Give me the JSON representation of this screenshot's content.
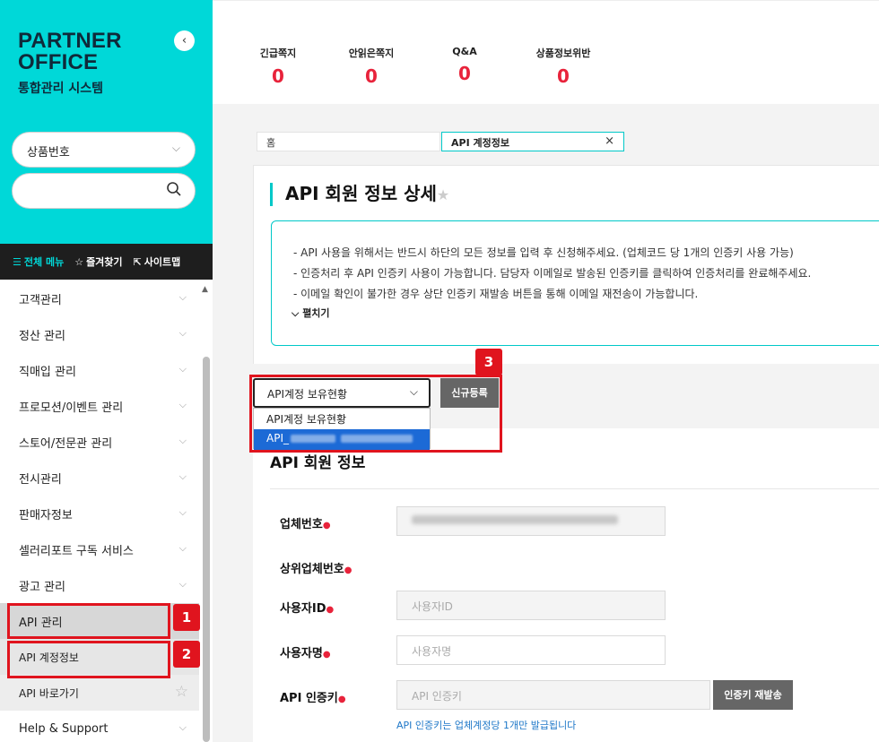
{
  "brand": {
    "line1": "PARTNER",
    "line2": "OFFICE",
    "subtitle": "통합관리 시스템"
  },
  "search": {
    "category": "상품번호",
    "query": ""
  },
  "menu_bar": {
    "all_menu": "전체 메뉴",
    "favorites": "즐겨찾기",
    "sitemap": "사이트맵"
  },
  "nav": {
    "items": [
      "고객관리",
      "정산 관리",
      "직매입 관리",
      "프로모션/이벤트 관리",
      "스토어/전문관 관리",
      "전시관리",
      "판매자정보",
      "셀러리포트 구독 서비스",
      "광고 관리"
    ],
    "api": "API 관리",
    "api_account": "API 계정정보",
    "api_shortcut": "API 바로가기",
    "help": "Help & Support"
  },
  "stats": [
    {
      "label": "긴급쪽지",
      "value": "0"
    },
    {
      "label": "안읽은쪽지",
      "value": "0"
    },
    {
      "label": "Q&A",
      "value": "0"
    },
    {
      "label": "상품정보위반",
      "value": "0"
    }
  ],
  "tabs": {
    "home": "홈",
    "active": "API 계정정보",
    "close": "×"
  },
  "page": {
    "title": "API 회원 정보 상세",
    "info": [
      "- API 사용을 위해서는 반드시 하단의 모든 정보를 입력 후 신청해주세요. (업체코드 당 1개의 인증키 사용 가능)",
      "- 인증처리 후 API 인증키 사용이 가능합니다. 담당자 이메일로 발송된 인증키를 클릭하여 인증처리를 완료해주세요.",
      "- 이메일 확인이 불가한 경우 상단 인증키 재발송 버튼을 통해 이메일 재전송이 가능합니다."
    ],
    "expand": "펼치기"
  },
  "account_select": {
    "selected": "API계정 보유현황",
    "register": "신규등록",
    "options": [
      "API계정 보유현황",
      "API_"
    ]
  },
  "form": {
    "section_title": "API 회원 정보",
    "company_no": "업체번호",
    "parent_company_no": "상위업체번호",
    "user_id_label": "사용자ID",
    "user_id_placeholder": "사용자ID",
    "user_name_label": "사용자명",
    "user_name_placeholder": "사용자명",
    "api_key_label": "API 인증키",
    "api_key_placeholder": "API 인증키",
    "reissue": "인증키 재발송",
    "hint": "API 인증키는 업체계정당 1개만 발급됩니다"
  },
  "annotations": [
    "1",
    "2",
    "3"
  ],
  "colors": {
    "brand": "#00d8d8",
    "accent": "#e8233b",
    "highlight": "#e0141e",
    "link": "#1f78c8"
  }
}
